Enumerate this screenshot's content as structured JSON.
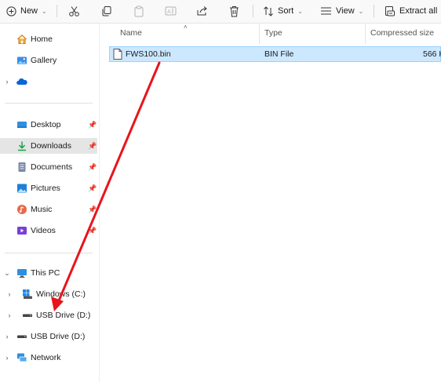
{
  "toolbar": {
    "new_label": "New",
    "sort_label": "Sort",
    "view_label": "View",
    "extract_label": "Extract all"
  },
  "sidebar": {
    "home": "Home",
    "gallery": "Gallery",
    "desktop": "Desktop",
    "downloads": "Downloads",
    "documents": "Documents",
    "pictures": "Pictures",
    "music": "Music",
    "videos": "Videos",
    "this_pc": "This PC",
    "windows_c": "Windows (C:)",
    "usb_drive_child": "USB Drive (D:)",
    "usb_drive_root": "USB Drive (D:)",
    "network": "Network"
  },
  "columns": {
    "name": "Name",
    "type": "Type",
    "compressed_size": "Compressed size"
  },
  "files": [
    {
      "name": "FWS100.bin",
      "type": "BIN File",
      "size": "566 K"
    }
  ],
  "colors": {
    "selection": "#cce8ff",
    "selection_border": "#99d1ff",
    "annotation_arrow": "#e8141c"
  }
}
